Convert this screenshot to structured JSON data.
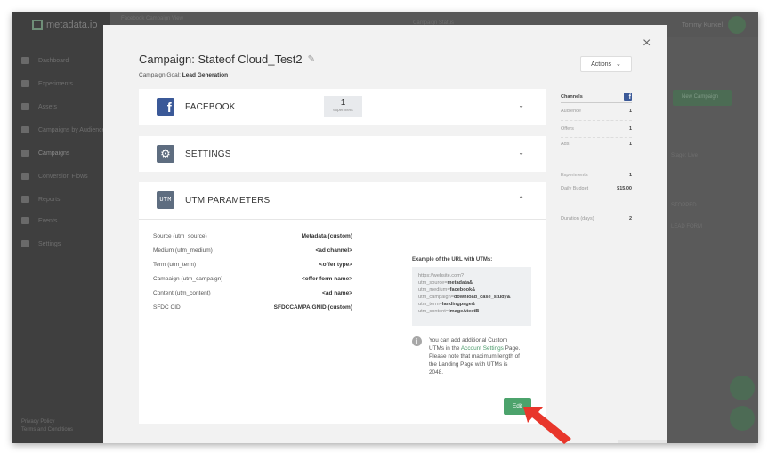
{
  "background": {
    "logo": "metadata.io",
    "top_title": "Facebook Campaign View",
    "top_center": "Campaign Status",
    "user_name": "Tommy Kunkel",
    "nav": [
      "Dashboard",
      "Experiments",
      "Assets",
      "Campaigns by Audience",
      "Campaigns",
      "Conversion Flows",
      "Reports",
      "Events",
      "Settings"
    ],
    "side_texts": [
      "Stage: Live",
      "STOPPED",
      "LEAD FORM",
      "New Campaign"
    ],
    "footer": [
      "Privacy Policy",
      "Terms and Conditions"
    ]
  },
  "modal": {
    "close_glyph": "×",
    "title": "Campaign: Stateof Cloud_Test2",
    "goal_label": "Campaign Goal:",
    "goal_value": "Lead Generation",
    "actions_label": "Actions",
    "facebook": {
      "label": "FACEBOOK",
      "experiment_count": "1",
      "experiment_label": "experiment"
    },
    "settings": {
      "label": "SETTINGS"
    },
    "utm": {
      "label": "UTM PARAMETERS",
      "icon_text": "UTM",
      "rows": [
        {
          "key": "Source (utm_source)",
          "value": "Metadata (custom)"
        },
        {
          "key": "Medium (utm_medium)",
          "value": "<ad channel>"
        },
        {
          "key": "Term (utm_term)",
          "value": "<offer type>"
        },
        {
          "key": "Campaign (utm_campaign)",
          "value": "<offer form name>"
        },
        {
          "key": "Content (utm_content)",
          "value": "<ad name>"
        },
        {
          "key": "SFDC CID",
          "value": "SFDCCAMPAIGNID (custom)"
        }
      ],
      "example_title": "Example of the URL with UTMs:",
      "example_lines": [
        {
          "k": "https://website.com?",
          "v": ""
        },
        {
          "k": "utm_source=",
          "v": "metadata&"
        },
        {
          "k": "utm_medium=",
          "v": "facebook&"
        },
        {
          "k": "utm_campaign=",
          "v": "download_case_study&"
        },
        {
          "k": "utm_term=",
          "v": "landingpage&"
        },
        {
          "k": "utm_content=",
          "v": "imageAtestB"
        }
      ],
      "info_before": "You can add additional Custom UTMs in the",
      "info_link": "Account Settings",
      "info_after": "Page. Please note that maximum length of the Landing Page with UTMs is 2048.",
      "edit_label": "Edit"
    },
    "stats": {
      "header": "Channels",
      "rows": [
        {
          "label": "Audience",
          "value": "1"
        },
        {
          "label": "Offers",
          "value": "1"
        },
        {
          "label": "Ads",
          "value": "1"
        },
        {
          "label": "Experiments",
          "value": "1"
        },
        {
          "label": "Daily Budget",
          "value": "$15.00"
        },
        {
          "label": "Duration (days)",
          "value": "2"
        }
      ]
    }
  },
  "colors": {
    "facebook": "#3b5998",
    "accent_green": "#4ca36c",
    "arrow_red": "#e8362b"
  }
}
